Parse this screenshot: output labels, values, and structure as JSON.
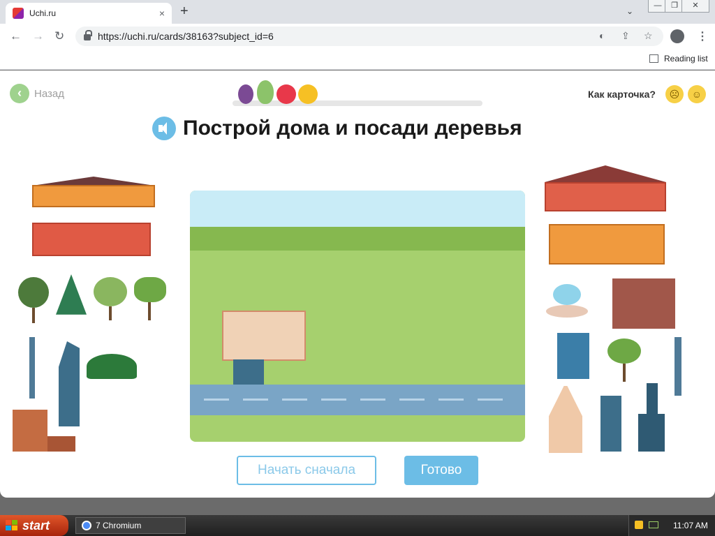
{
  "browser": {
    "tab_title": "Uchi.ru",
    "tab_close": "×",
    "new_tab": "+",
    "tab_search": "⌄",
    "window_controls": [
      "—",
      "❐",
      "✕"
    ],
    "back": "←",
    "forward": "→",
    "reload": "↻",
    "url": "https://uchi.ru/cards/38163?subject_id=6",
    "reading_list": "Reading list"
  },
  "page": {
    "back_label": "Назад",
    "back_icon": "‹",
    "rating_label": "Как карточка?",
    "rating_faces": [
      "☹",
      "☺"
    ],
    "title": "Построй дома и посади деревья",
    "restart_label": "Начать сначала",
    "done_label": "Готово",
    "progress_fruits": [
      "plum",
      "pear",
      "apple",
      "orange"
    ],
    "fruit_colors": {
      "plum": "#7b4a94",
      "pear": "#8cc36a",
      "apple": "#e8384a",
      "orange": "#f6c024"
    }
  },
  "taskbar": {
    "start_label": "start",
    "task_label": "7 Chromium",
    "clock": "11:07 AM"
  }
}
